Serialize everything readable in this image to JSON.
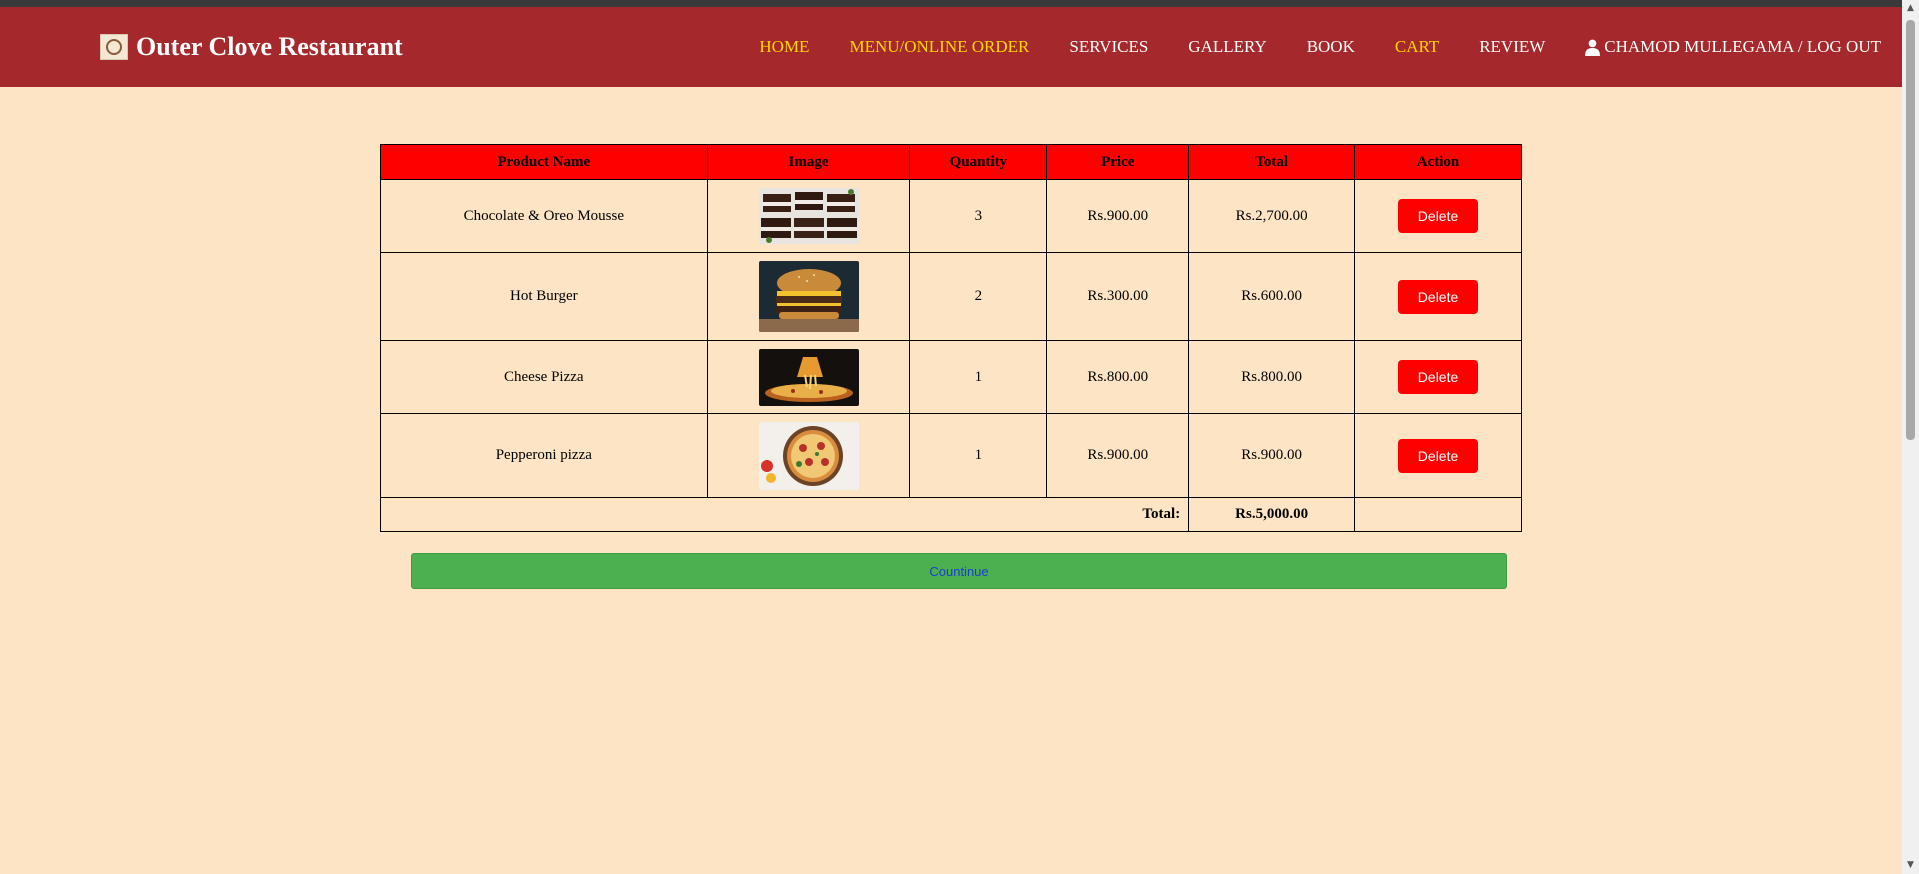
{
  "brand": {
    "name": "Outer Clove Restaurant"
  },
  "nav": {
    "items": [
      {
        "label": "HOME",
        "active": true
      },
      {
        "label": "MENU/ONLINE ORDER",
        "active": true
      },
      {
        "label": "SERVICES",
        "active": false
      },
      {
        "label": "GALLERY",
        "active": false
      },
      {
        "label": "BOOK",
        "active": false
      },
      {
        "label": "CART",
        "active": true
      },
      {
        "label": "REVIEW",
        "active": false
      }
    ],
    "user_label": "CHAMOD MULLEGAMA / LOG OUT"
  },
  "table": {
    "headers": [
      "Product Name",
      "Image",
      "Quantity",
      "Price",
      "Total",
      "Action"
    ],
    "rows": [
      {
        "name": "Chocolate & Oreo Mousse",
        "quantity": "3",
        "price": "Rs.900.00",
        "total": "Rs.2,700.00",
        "action": "Delete",
        "image": "chocolate-oreo-mousse-photo"
      },
      {
        "name": "Hot Burger",
        "quantity": "2",
        "price": "Rs.300.00",
        "total": "Rs.600.00",
        "action": "Delete",
        "image": "hot-burger-photo"
      },
      {
        "name": "Cheese Pizza",
        "quantity": "1",
        "price": "Rs.800.00",
        "total": "Rs.800.00",
        "action": "Delete",
        "image": "cheese-pizza-photo"
      },
      {
        "name": "Pepperoni pizza",
        "quantity": "1",
        "price": "Rs.900.00",
        "total": "Rs.900.00",
        "action": "Delete",
        "image": "pepperoni-pizza-photo"
      }
    ],
    "total_label": "Total:",
    "total_value": "Rs.5,000.00"
  },
  "continue_label": "Countinue",
  "colors": {
    "navbar": "#a5282c",
    "page_bg": "#fde4c4",
    "header_row": "#ff0000",
    "delete_button": "#ff0000",
    "continue_button": "#4caf50",
    "active_nav": "#ffd700"
  }
}
